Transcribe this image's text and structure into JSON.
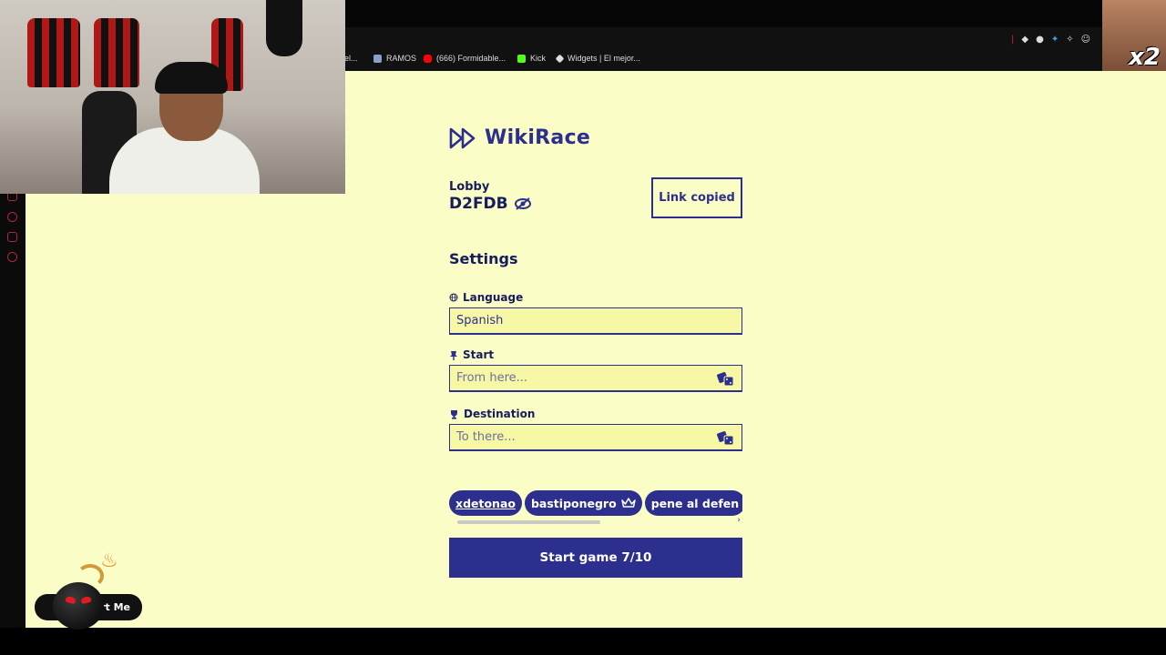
{
  "browser": {
    "bookmarks": [
      {
        "label": "el...",
        "icon": "folder-icon",
        "color": "#888888"
      },
      {
        "label": "RAMOS",
        "icon": "image-icon",
        "color": "#8aa1c7"
      },
      {
        "label": "(666) Formidable...",
        "icon": "youtube-icon",
        "color": "#ff0000"
      },
      {
        "label": "Kick",
        "icon": "kick-icon",
        "color": "#53fc18"
      },
      {
        "label": "Widgets | El mejor...",
        "icon": "widget-icon",
        "color": "#dddddd"
      }
    ]
  },
  "overlay": {
    "corner_badge": "x2",
    "widget_label": "rt Me"
  },
  "app": {
    "title": "WikiRace",
    "lobby_label": "Lobby",
    "lobby_code": "D2FDB",
    "link_button": "Link copied",
    "settings_title": "Settings",
    "language_label": "Language",
    "language_value": "Spanish",
    "start_label": "Start",
    "start_placeholder": "From here...",
    "destination_label": "Destination",
    "destination_placeholder": "To there...",
    "players": [
      {
        "name": "xdetonao",
        "is_me": true,
        "is_host": false
      },
      {
        "name": "bastiponegro",
        "is_me": false,
        "is_host": true
      },
      {
        "name": "pene al defen",
        "is_me": false,
        "is_host": false
      }
    ],
    "start_button": "Start game 7/10"
  },
  "colors": {
    "background": "#fbfdc6",
    "primary": "#2d2f8f",
    "input_bg": "#f6f8a6"
  }
}
